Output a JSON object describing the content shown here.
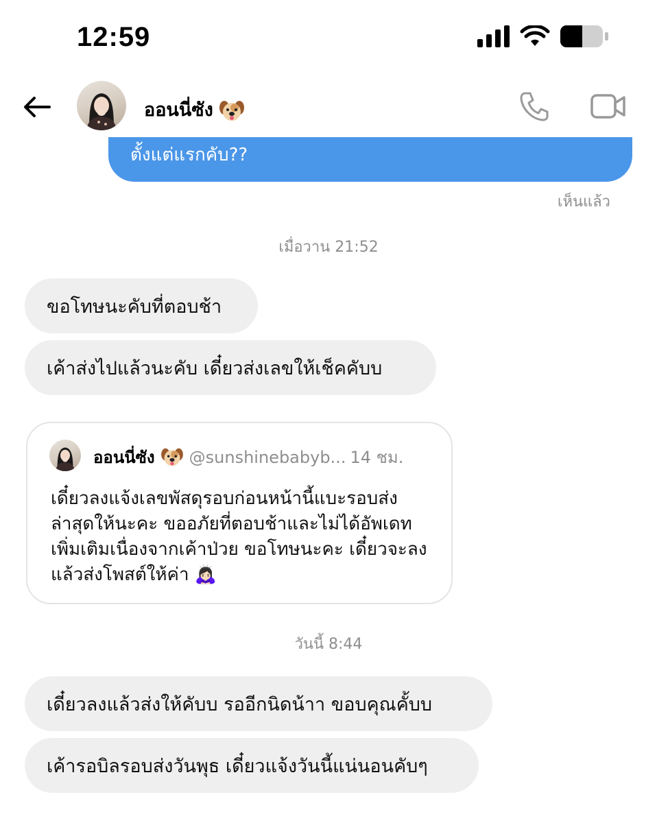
{
  "status_bar": {
    "time": "12:59"
  },
  "header": {
    "contact_name": "ออนนี่ซัง",
    "icons": [
      "back-arrow-icon",
      "phone-icon",
      "video-camera-icon",
      "dog-face-icon"
    ]
  },
  "messages": {
    "sent_partial_text": "ตั้งแต่แรกคับ??",
    "seen_label": "เห็นแล้ว",
    "timestamp_1": "เมื่อวาน 21:52",
    "received_1": "ขอโทษนะคับที่ตอบช้า",
    "received_2": "เค้าส่งไปแล้วนะคับ เดี๋ยวส่งเลขให้เช็คคับบ",
    "quoted_post": {
      "name": "ออนนี่ซัง",
      "handle": "@sunshinebabyb...",
      "time": "14 ชม.",
      "body": "เดี๋ยวลงแจ้งเลขพัสดุรอบก่อนหน้านี้แบะรอบส่งล่าสุดให้นะคะ ขออภัยที่ตอบช้าและไม่ได้อัพเดทเพิ่มเติมเนื่องจากเค้าป่วย ขอโทษนะคะ เดี๋ยวจะลงแล้วส่งโพสต์ให้ค่า 🙇🏻‍♀️"
    },
    "timestamp_2": "วันนี้ 8:44",
    "received_3": "เดี๋ยวลงแล้วส่งให้คับบ รออีกนิดน้าา ขอบคุณคั้บบ",
    "received_4": "เค้ารอบิลรอบส่งวันพุธ เดี๋ยวแจ้งวันนี้แน่นอนคับๆ"
  },
  "colors": {
    "sent_bubble": "#4a96e8",
    "received_bubble": "#efefef",
    "secondary_text": "#8e8e8e"
  }
}
